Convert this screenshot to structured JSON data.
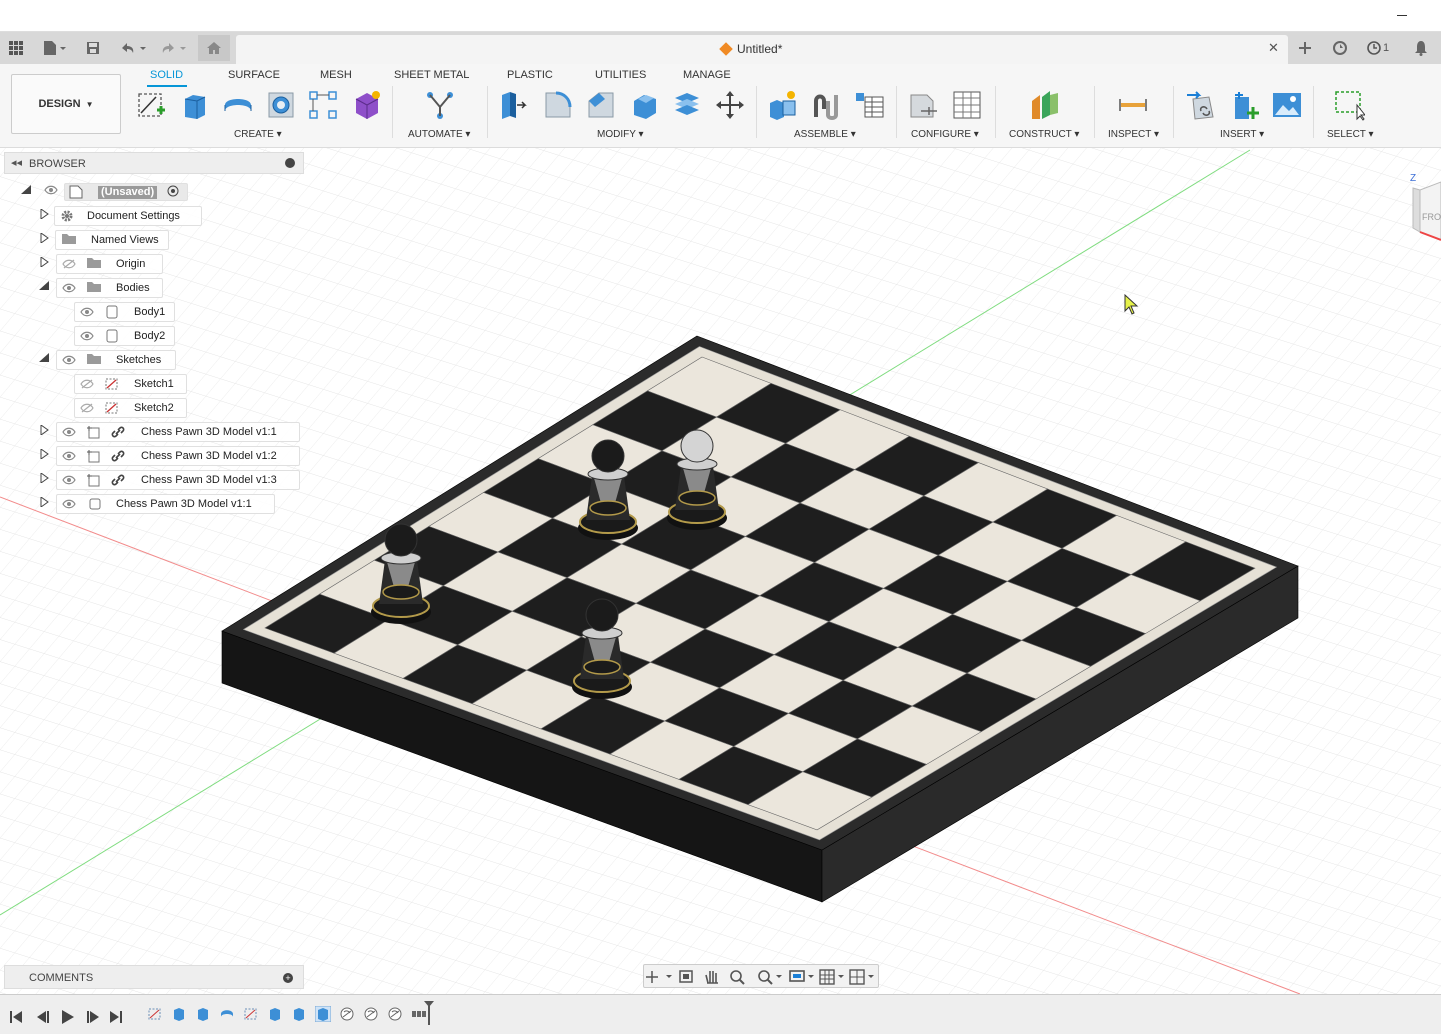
{
  "document": {
    "title": "Untitled*"
  },
  "workspace": {
    "label": "DESIGN"
  },
  "ribbon_tabs": [
    "SOLID",
    "SURFACE",
    "MESH",
    "SHEET METAL",
    "PLASTIC",
    "UTILITIES",
    "MANAGE"
  ],
  "groups": {
    "create": "CREATE",
    "automate": "AUTOMATE",
    "modify": "MODIFY",
    "assemble": "ASSEMBLE",
    "configure": "CONFIGURE",
    "construct": "CONSTRUCT",
    "inspect": "INSPECT",
    "insert": "INSERT",
    "select": "SELECT"
  },
  "notifications": {
    "count": "1"
  },
  "browser": {
    "title": "BROWSER",
    "root": "(Unsaved)",
    "items": [
      {
        "label": "Document Settings"
      },
      {
        "label": "Named Views"
      },
      {
        "label": "Origin"
      },
      {
        "label": "Bodies"
      },
      {
        "label": "Body1"
      },
      {
        "label": "Body2"
      },
      {
        "label": "Sketches"
      },
      {
        "label": "Sketch1"
      },
      {
        "label": "Sketch2"
      },
      {
        "label": "Chess Pawn 3D Model v1:1"
      },
      {
        "label": "Chess Pawn 3D Model v1:2"
      },
      {
        "label": "Chess Pawn 3D Model v1:3"
      },
      {
        "label": "Chess Pawn 3D Model v1:1"
      }
    ]
  },
  "comments": {
    "title": "COMMENTS"
  },
  "viewcube": {
    "axis": "Z",
    "face": "FRO"
  },
  "colors": {
    "accent": "#0696d7",
    "board_dark": "#222222",
    "board_light": "#e6e1d6"
  }
}
